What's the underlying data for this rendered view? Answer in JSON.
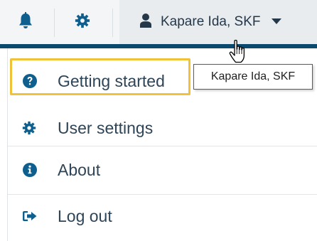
{
  "topbar": {
    "notifications_icon": "bell-icon",
    "settings_icon": "gear-icon",
    "user": {
      "icon": "person-icon",
      "name": "Kapare Ida, SKF",
      "caret_icon": "caret-down-icon"
    }
  },
  "menu": {
    "items": [
      {
        "icon": "question-circle-icon",
        "label": "Getting started"
      },
      {
        "icon": "gear-icon",
        "label": "User settings"
      },
      {
        "icon": "info-circle-icon",
        "label": "About"
      },
      {
        "icon": "sign-out-icon",
        "label": "Log out"
      }
    ]
  },
  "tooltip": {
    "text": "Kapare Ida, SKF"
  },
  "colors": {
    "accent": "#0b4a6e",
    "icon": "#0e5f8e",
    "highlight": "#f0c23a",
    "text": "#2e4457"
  }
}
